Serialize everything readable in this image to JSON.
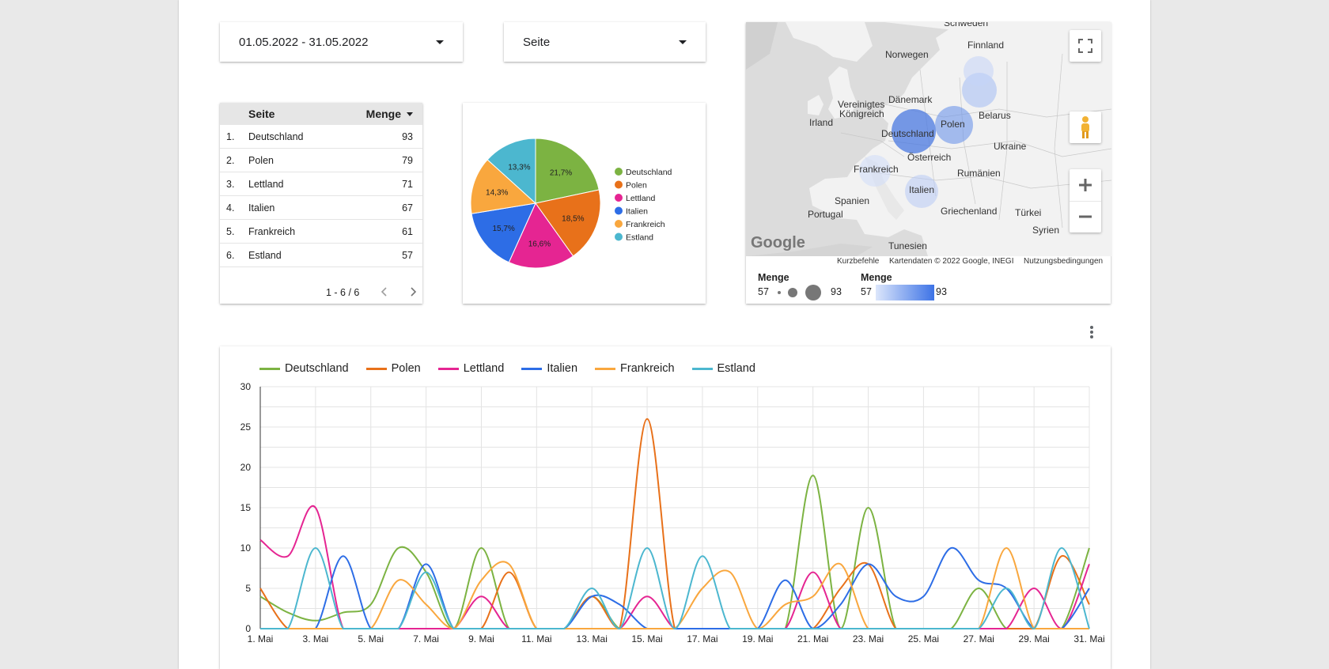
{
  "filters": {
    "date_range": "01.05.2022 - 31.05.2022",
    "dimension": "Seite"
  },
  "table": {
    "col_name": "Seite",
    "col_value": "Menge",
    "rows": [
      {
        "idx": "1.",
        "name": "Deutschland",
        "value": "93"
      },
      {
        "idx": "2.",
        "name": "Polen",
        "value": "79"
      },
      {
        "idx": "3.",
        "name": "Lettland",
        "value": "71"
      },
      {
        "idx": "4.",
        "name": "Italien",
        "value": "67"
      },
      {
        "idx": "5.",
        "name": "Frankreich",
        "value": "61"
      },
      {
        "idx": "6.",
        "name": "Estland",
        "value": "57"
      }
    ],
    "pager": "1 - 6 / 6"
  },
  "colors": {
    "Deutschland": "#7cb342",
    "Polen": "#e8711a",
    "Lettland": "#e52592",
    "Italien": "#2d6de6",
    "Frankreich": "#f9a73e",
    "Estland": "#4cb7cf"
  },
  "map": {
    "labels": {
      "schweden": "Schweden",
      "finnland": "Finnland",
      "norwegen": "Norwegen",
      "daenemark": "Dänemark",
      "vk1": "Vereinigtes",
      "vk2": "Königreich",
      "irland": "Irland",
      "belarus": "Belarus",
      "deutschland": "Deutschland",
      "polen": "Polen",
      "ukraine": "Ukraine",
      "oesterreich": "Österreich",
      "frankreich": "Frankreich",
      "rumaenien": "Rumänien",
      "italien": "Italien",
      "spanien": "Spanien",
      "portugal": "Portugal",
      "griechenland": "Griechenland",
      "tuerkei": "Türkei",
      "syrien": "Syrien",
      "tunesien": "Tunesien"
    },
    "footer": {
      "google": "Google",
      "shortcuts": "Kurzbefehle",
      "mapdata": "Kartendaten © 2022 Google, INEGI",
      "terms": "Nutzungsbedingungen"
    },
    "legend": {
      "size_title": "Menge",
      "size_min": "57",
      "size_max": "93",
      "color_title": "Menge",
      "color_min": "57",
      "color_max": "93"
    }
  },
  "chart_data": [
    {
      "type": "pie",
      "title": "",
      "categories": [
        "Deutschland",
        "Polen",
        "Lettland",
        "Italien",
        "Frankreich",
        "Estland"
      ],
      "values": [
        21.7,
        18.5,
        16.6,
        15.7,
        14.3,
        13.3
      ],
      "labels": [
        "21,7%",
        "18,5%",
        "16,6%",
        "15,7%",
        "14,3%",
        "13,3%"
      ],
      "legend_position": "right"
    },
    {
      "type": "line",
      "title": "",
      "xlabel": "",
      "ylabel": "",
      "legend_position": "top",
      "grid": true,
      "ylim": [
        0,
        30
      ],
      "y_ticks": [
        "0",
        "5",
        "10",
        "15",
        "20",
        "25",
        "30"
      ],
      "x_tick_labels": [
        "1. Mai",
        "3. Mai",
        "5. Mai",
        "7. Mai",
        "9. Mai",
        "11. Mai",
        "13. Mai",
        "15. Mai",
        "17. Mai",
        "19. Mai",
        "21. Mai",
        "23. Mai",
        "25. Mai",
        "27. Mai",
        "29. Mai",
        "31. Mai"
      ],
      "x": [
        1,
        2,
        3,
        4,
        5,
        6,
        7,
        8,
        9,
        10,
        11,
        12,
        13,
        14,
        15,
        16,
        17,
        18,
        19,
        20,
        21,
        22,
        23,
        24,
        25,
        26,
        27,
        28,
        29,
        30,
        31
      ],
      "series": [
        {
          "name": "Deutschland",
          "values": [
            4,
            2,
            1,
            2,
            3,
            10,
            7,
            0,
            10,
            0,
            0,
            0,
            4,
            0,
            0,
            0,
            0,
            0,
            0,
            0,
            19,
            0,
            15,
            0,
            0,
            0,
            5,
            0,
            0,
            0,
            10
          ]
        },
        {
          "name": "Polen",
          "values": [
            5,
            0,
            0,
            0,
            0,
            0,
            0,
            0,
            0,
            7,
            0,
            0,
            4,
            0,
            26,
            0,
            0,
            0,
            0,
            0,
            0,
            5,
            8,
            0,
            0,
            0,
            0,
            0,
            0,
            9,
            3
          ]
        },
        {
          "name": "Lettland",
          "values": [
            11,
            9,
            15,
            0,
            0,
            0,
            0,
            0,
            4,
            0,
            0,
            0,
            0,
            0,
            4,
            0,
            0,
            0,
            0,
            0,
            7,
            0,
            0,
            0,
            0,
            0,
            0,
            0,
            5,
            0,
            8
          ]
        },
        {
          "name": "Italien",
          "values": [
            0,
            0,
            0,
            9,
            0,
            0,
            8,
            0,
            0,
            0,
            0,
            0,
            4,
            3,
            0,
            0,
            0,
            0,
            0,
            6,
            0,
            3,
            8,
            4,
            4,
            10,
            6,
            5,
            0,
            0,
            5
          ]
        },
        {
          "name": "Frankreich",
          "values": [
            0,
            0,
            0,
            0,
            0,
            6,
            3,
            0,
            6,
            8,
            0,
            0,
            0,
            0,
            0,
            0,
            5,
            7,
            0,
            3,
            4,
            8,
            0,
            0,
            0,
            0,
            0,
            10,
            0,
            0,
            0
          ]
        },
        {
          "name": "Estland",
          "values": [
            0,
            0,
            10,
            0,
            0,
            0,
            7,
            0,
            0,
            0,
            0,
            0,
            5,
            0,
            10,
            0,
            9,
            0,
            0,
            0,
            0,
            0,
            0,
            0,
            0,
            0,
            0,
            5,
            0,
            10,
            0
          ]
        }
      ]
    }
  ]
}
